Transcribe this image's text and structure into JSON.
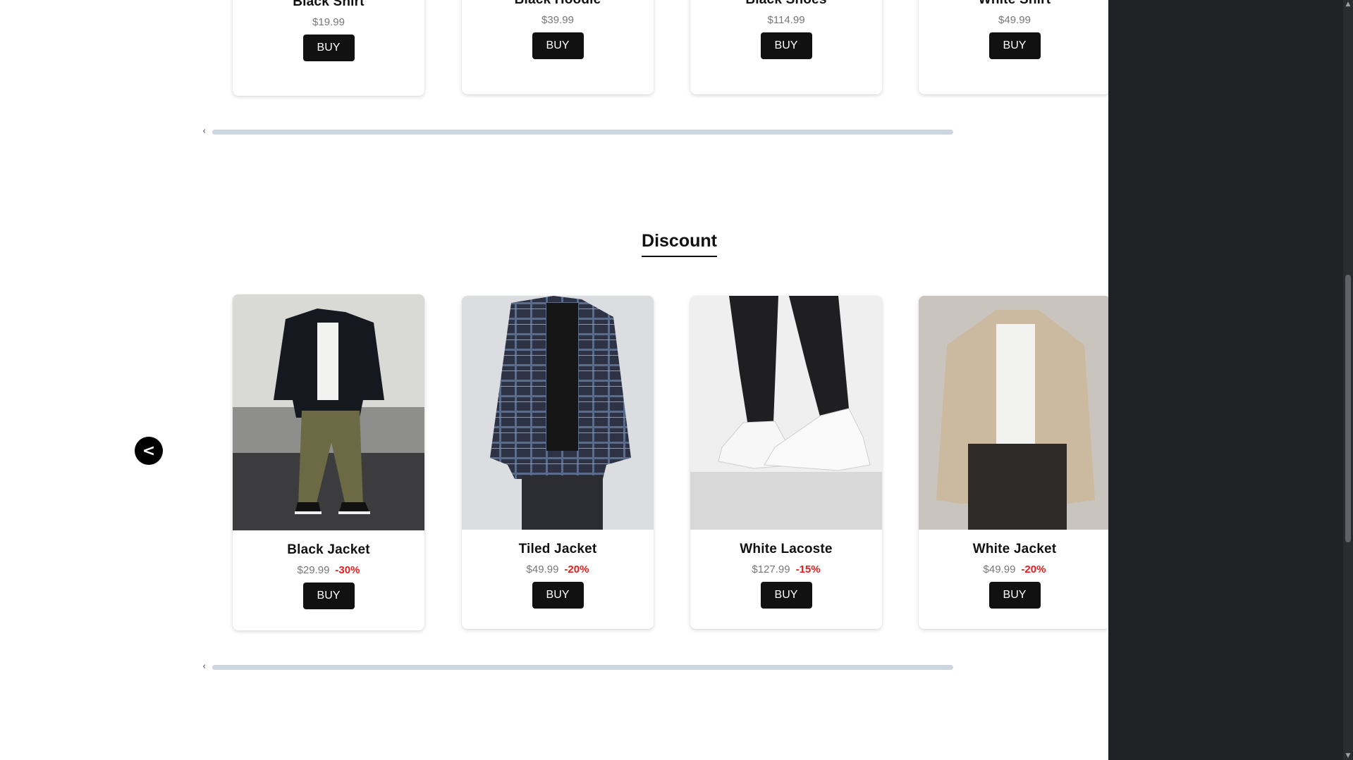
{
  "top_row": [
    {
      "name": "Black Shirt",
      "price": "$19.99",
      "buy": "BUY"
    },
    {
      "name": "Black Hoodie",
      "price": "$39.99",
      "buy": "BUY"
    },
    {
      "name": "Black Shoes",
      "price": "$114.99",
      "buy": "BUY"
    },
    {
      "name": "White Shirt",
      "price": "$49.99",
      "buy": "BUY"
    }
  ],
  "discount": {
    "title": "Discount",
    "prev_label": "<",
    "next_label": ">",
    "items": [
      {
        "name": "Black Jacket",
        "price": "$29.99",
        "discount": "-30%",
        "buy": "BUY"
      },
      {
        "name": "Tiled Jacket",
        "price": "$49.99",
        "discount": "-20%",
        "buy": "BUY"
      },
      {
        "name": "White Lacoste",
        "price": "$127.99",
        "discount": "-15%",
        "buy": "BUY"
      },
      {
        "name": "White Jacket",
        "price": "$49.99",
        "discount": "-20%",
        "buy": "BUY"
      }
    ]
  },
  "scrollbar_arrows": {
    "left": "‹",
    "right": "›",
    "up": "▲",
    "down": "▼"
  },
  "colors": {
    "accent": "#111111",
    "discount": "#e02020",
    "price": "#777777",
    "scroll_thumb": "#cdd6df"
  }
}
